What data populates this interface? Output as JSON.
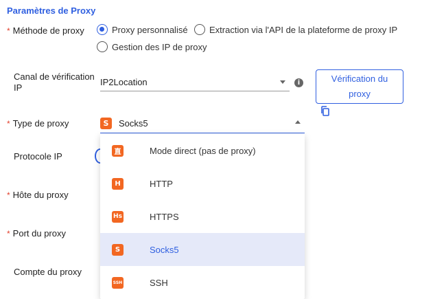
{
  "section_title": "Paramètres de Proxy",
  "required_mark": "*",
  "method": {
    "label": "Méthode de proxy",
    "options": [
      {
        "label": "Proxy personnalisé",
        "checked": true
      },
      {
        "label": "Extraction via l'API de la plateforme de proxy IP",
        "checked": false
      },
      {
        "label": "Gestion des IP de proxy",
        "checked": false
      }
    ]
  },
  "ip_check": {
    "label_line1": "Canal de vérification",
    "label_line2": "IP",
    "value": "IP2Location",
    "info_icon": "i",
    "verify_button": "Vérification du proxy"
  },
  "proxy_type": {
    "label": "Type de proxy",
    "value": "Socks5",
    "badge": "S",
    "options": [
      {
        "badge": "直",
        "label": "Mode direct (pas de proxy)",
        "selected": false
      },
      {
        "badge": "H",
        "label": "HTTP",
        "selected": false
      },
      {
        "badge": "Hs",
        "label": "HTTPS",
        "selected": false
      },
      {
        "badge": "S",
        "label": "Socks5",
        "selected": true
      },
      {
        "badge": "SSH",
        "label": "SSH",
        "selected": false
      }
    ]
  },
  "protocol": {
    "label": "Protocole IP"
  },
  "host": {
    "label": "Hôte du proxy"
  },
  "port": {
    "label": "Port du proxy"
  },
  "account": {
    "label": "Compte du proxy"
  },
  "colors": {
    "accent": "#2f5fe0",
    "badge": "#f26722",
    "required": "#e2402d",
    "selected_bg": "#e5e9f9"
  }
}
